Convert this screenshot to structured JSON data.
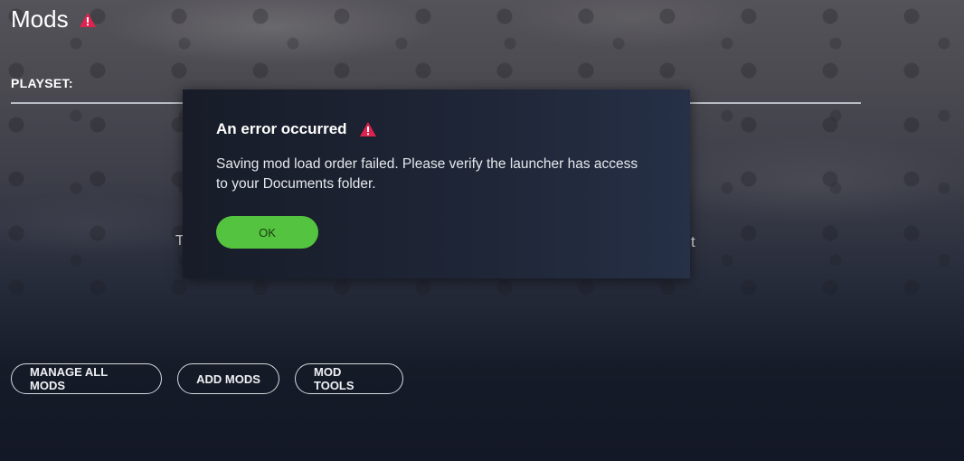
{
  "header": {
    "title": "Mods",
    "warning_icon": "warning-triangle-icon"
  },
  "playset": {
    "label": "PLAYSET:"
  },
  "obscured": {
    "left_fragment": "T",
    "right_fragment": "t"
  },
  "actions": {
    "manage_all_mods": "MANAGE ALL MODS",
    "add_mods": "ADD MODS",
    "mod_tools": "MOD TOOLS"
  },
  "dialog": {
    "title": "An error occurred",
    "message_line1": "Saving mod load order failed. Please verify the launcher has access",
    "message_line2": "to your Documents folder.",
    "ok_label": "OK"
  },
  "colors": {
    "warning": "#e0224e",
    "ok_button": "#54c33f",
    "dialog_bg": "#1f2637"
  }
}
